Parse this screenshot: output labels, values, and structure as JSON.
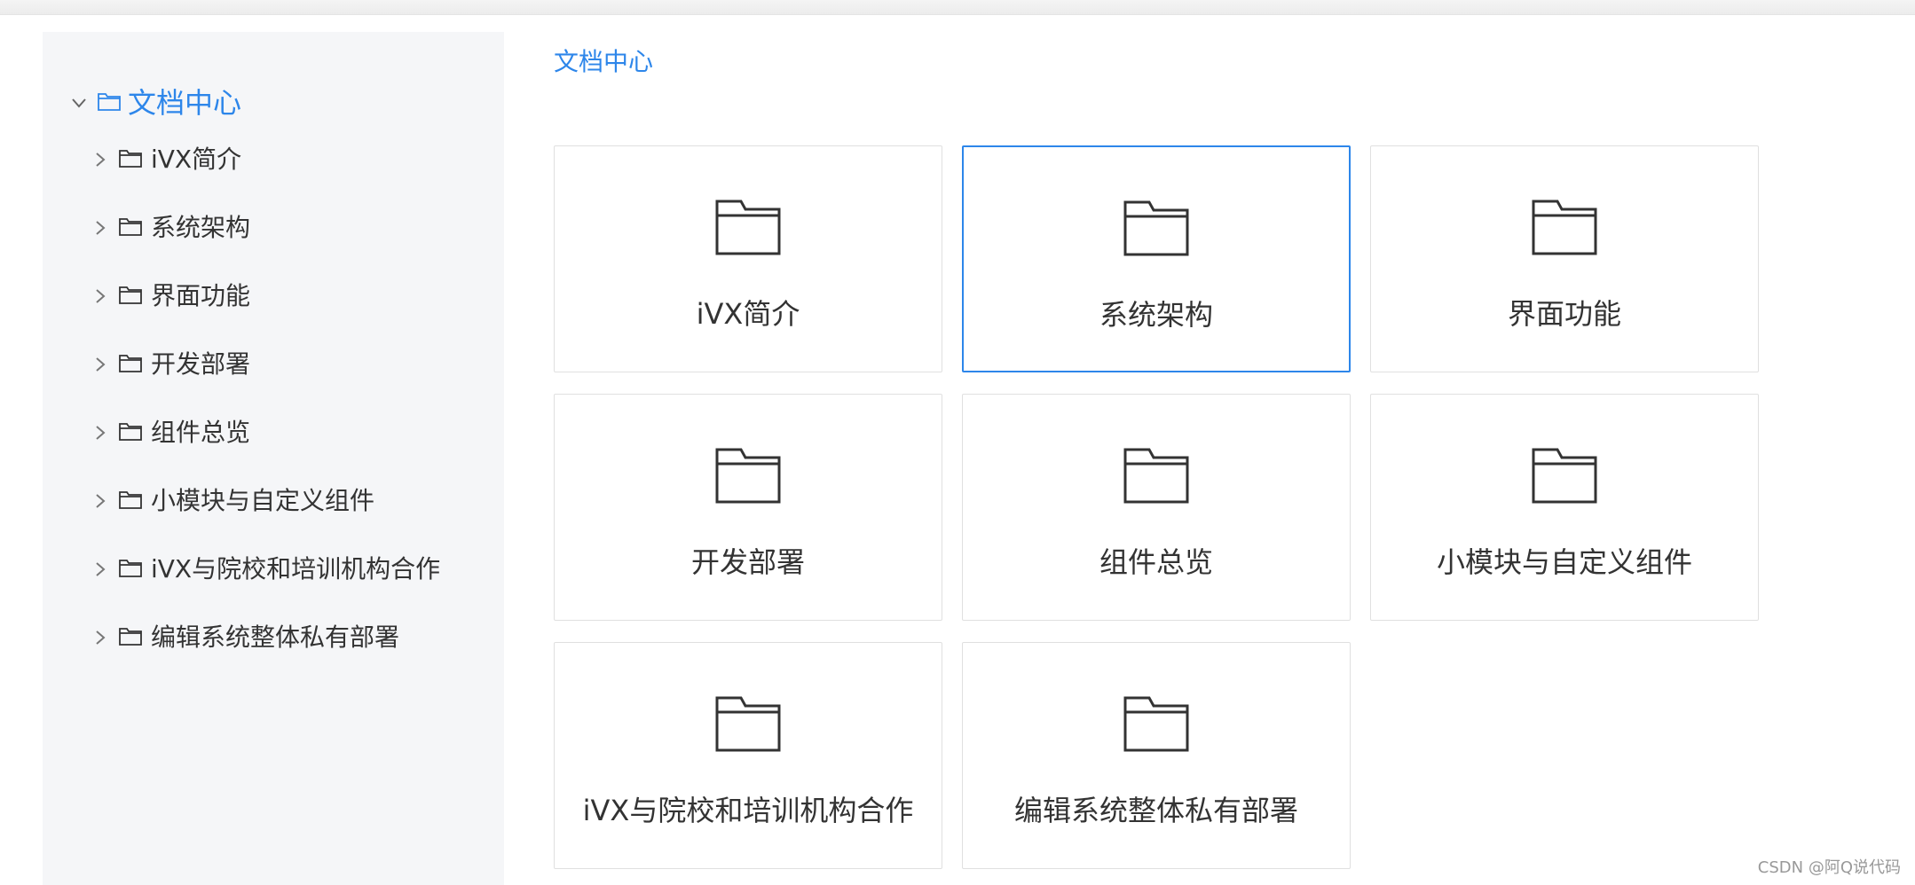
{
  "sidebar": {
    "root": {
      "label": "文档中心",
      "expanded": true,
      "icon": "folder-icon",
      "chevron": "chevron-down-icon"
    },
    "items": [
      {
        "label": "iVX简介",
        "icon": "folder-icon",
        "chevron": "chevron-right-icon"
      },
      {
        "label": "系统架构",
        "icon": "folder-icon",
        "chevron": "chevron-right-icon"
      },
      {
        "label": "界面功能",
        "icon": "folder-icon",
        "chevron": "chevron-right-icon"
      },
      {
        "label": "开发部署",
        "icon": "folder-icon",
        "chevron": "chevron-right-icon"
      },
      {
        "label": "组件总览",
        "icon": "folder-icon",
        "chevron": "chevron-right-icon"
      },
      {
        "label": "小模块与自定义组件",
        "icon": "folder-icon",
        "chevron": "chevron-right-icon"
      },
      {
        "label": "iVX与院校和培训机构合作",
        "icon": "folder-icon",
        "chevron": "chevron-right-icon"
      },
      {
        "label": "编辑系统整体私有部署",
        "icon": "folder-icon",
        "chevron": "chevron-right-icon"
      }
    ]
  },
  "breadcrumb": {
    "label": "文档中心"
  },
  "cards": [
    {
      "label": "iVX简介",
      "icon": "folder-icon",
      "active": false
    },
    {
      "label": "系统架构",
      "icon": "folder-icon",
      "active": true
    },
    {
      "label": "界面功能",
      "icon": "folder-icon",
      "active": false
    },
    {
      "label": "开发部署",
      "icon": "folder-icon",
      "active": false
    },
    {
      "label": "组件总览",
      "icon": "folder-icon",
      "active": false
    },
    {
      "label": "小模块与自定义组件",
      "icon": "folder-icon",
      "active": false
    },
    {
      "label": "iVX与院校和培训机构合作",
      "icon": "folder-icon",
      "active": false
    },
    {
      "label": "编辑系统整体私有部署",
      "icon": "folder-icon",
      "active": false
    }
  ],
  "watermark": "CSDN @阿Q说代码",
  "colors": {
    "accent": "#2d86ea",
    "text": "#333333",
    "sidebar_bg": "#f5f6f8",
    "card_border": "#e0e0e0"
  }
}
